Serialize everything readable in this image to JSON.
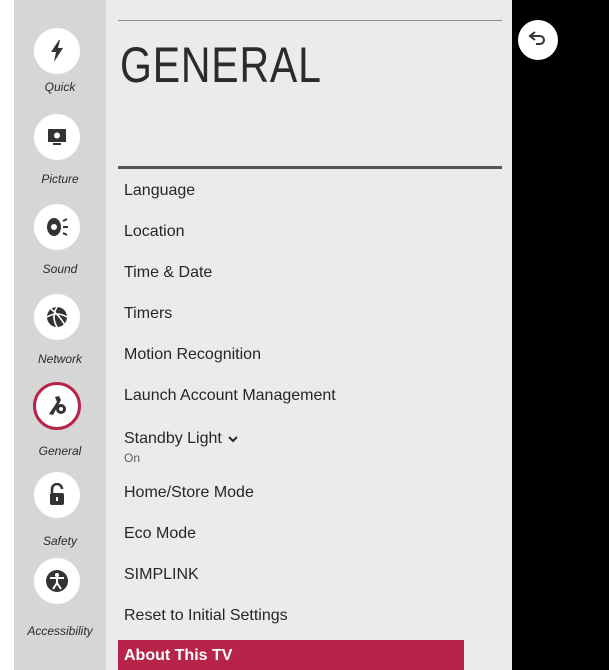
{
  "header": {
    "title": "GENERAL"
  },
  "rail": {
    "items": [
      {
        "label": "Quick",
        "icon": "lightning-icon"
      },
      {
        "label": "Picture",
        "icon": "picture-icon"
      },
      {
        "label": "Sound",
        "icon": "sound-icon"
      },
      {
        "label": "Network",
        "icon": "globe-icon"
      },
      {
        "label": "General",
        "icon": "wrench-gear-icon",
        "active": true
      },
      {
        "label": "Safety",
        "icon": "lock-icon"
      },
      {
        "label": "Accessibility",
        "icon": "accessibility-icon"
      }
    ]
  },
  "menu": {
    "items": [
      {
        "label": "Language"
      },
      {
        "label": "Location"
      },
      {
        "label": "Time & Date"
      },
      {
        "label": "Timers"
      },
      {
        "label": "Motion Recognition"
      },
      {
        "label": "Launch Account Management"
      },
      {
        "label": "Standby Light",
        "value": "On",
        "expandable": true
      },
      {
        "label": "Home/Store Mode"
      },
      {
        "label": "Eco Mode"
      },
      {
        "label": "SIMPLINK"
      },
      {
        "label": "Reset to Initial Settings"
      },
      {
        "label": "About This TV",
        "selected": true
      }
    ]
  },
  "colors": {
    "accent": "#b6244a",
    "panel": "#ebebeb",
    "rail": "#d6d6d6"
  },
  "back": {
    "icon": "back-arrow-icon"
  }
}
